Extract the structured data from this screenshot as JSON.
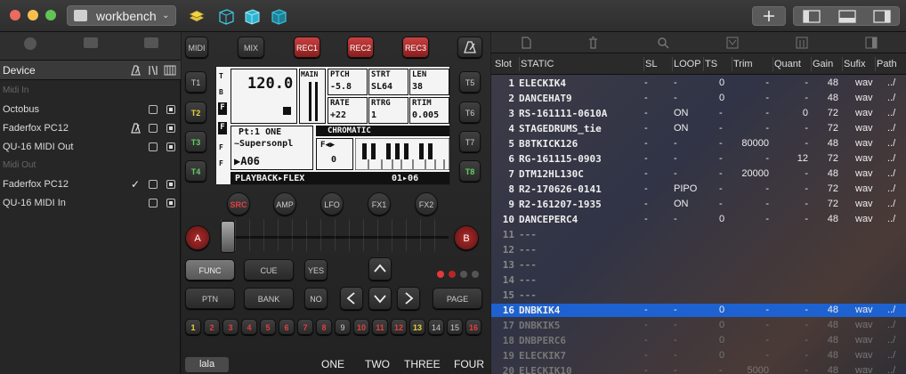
{
  "window": {
    "workspace": "workbench",
    "close_color": "#ed6a5e",
    "minimize_color": "#f5bf4f",
    "zoom_color": "#61c454"
  },
  "left": {
    "header": "Device",
    "sections": [
      {
        "title": "Midi In",
        "items": [
          {
            "name": "Octobus",
            "checked": false
          },
          {
            "name": "Faderfox PC12",
            "checked": false
          },
          {
            "name": "QU-16 MIDI Out",
            "checked": false
          }
        ]
      },
      {
        "title": "Midi Out",
        "items": [
          {
            "name": "Faderfox PC12",
            "checked": true
          },
          {
            "name": "QU-16 MIDI In",
            "checked": false
          }
        ]
      }
    ],
    "checkmark": "✓"
  },
  "device": {
    "top_buttons": {
      "midi": "MIDI",
      "mix": "MIX",
      "rec1": "REC1",
      "rec2": "REC2",
      "rec3": "REC3"
    },
    "tracks_left": [
      "T1",
      "T2",
      "T3",
      "T4"
    ],
    "tracks_right": [
      "T5",
      "T6",
      "T7",
      "T8"
    ],
    "screen": {
      "tempo": "120.0",
      "main": "MAIN",
      "params_top": [
        {
          "label": "PTCH",
          "value": "-5.8"
        },
        {
          "label": "STRT",
          "value": "SL64"
        },
        {
          "label": "LEN",
          "value": "38"
        }
      ],
      "params_bottom": [
        {
          "label": "RATE",
          "value": "+22"
        },
        {
          "label": "RTRG",
          "value": "1"
        },
        {
          "label": "RTIM",
          "value": "0.005"
        }
      ],
      "part": "Pt:1 ONE",
      "sound": "~Supersonpl",
      "pattern": "A06",
      "mode": "CHROMATIC",
      "zero": "0",
      "footer_left": "PLAYBACK▸FLEX",
      "footer_right": "01▸06"
    },
    "row_buttons": {
      "src": "SRC",
      "amp": "AMP",
      "lfo": "LFO",
      "fx1": "FX1",
      "fx2": "FX2"
    },
    "crossfader": {
      "a": "A",
      "b": "B"
    },
    "func_buttons": {
      "func": "FUNC",
      "cue": "CUE",
      "yes": "YES",
      "ptn": "PTN",
      "bank": "BANK",
      "no": "NO",
      "page": "PAGE"
    },
    "trig_keys": [
      "1",
      "2",
      "3",
      "4",
      "5",
      "6",
      "7",
      "8",
      "9",
      "10",
      "11",
      "12",
      "13",
      "14",
      "15",
      "16"
    ],
    "part_label": "lala",
    "parts": [
      "ONE",
      "TWO",
      "THREE",
      "FOUR"
    ]
  },
  "table": {
    "columns": [
      "Slot",
      "STATIC",
      "SL",
      "LOOP",
      "TS",
      "Trim",
      "Quant",
      "Gain",
      "Sufix",
      "Path"
    ],
    "rows": [
      [
        "1",
        "ELECKIK4",
        "-",
        "-",
        "0",
        "-",
        "-",
        "48",
        "wav",
        "../"
      ],
      [
        "2",
        "DANCEHAT9",
        "-",
        "-",
        "0",
        "-",
        "-",
        "48",
        "wav",
        "../"
      ],
      [
        "3",
        "RS-161111-0610A",
        "-",
        "ON",
        "-",
        "-",
        "0",
        "72",
        "wav",
        "../"
      ],
      [
        "4",
        "STAGEDRUMS_tie",
        "-",
        "ON",
        "-",
        "-",
        "-",
        "72",
        "wav",
        "../"
      ],
      [
        "5",
        "B8TKICK126",
        "-",
        "-",
        "-",
        "80000",
        "-",
        "48",
        "wav",
        "../"
      ],
      [
        "6",
        "RG-161115-0903",
        "-",
        "-",
        "-",
        "-",
        "12",
        "72",
        "wav",
        "../"
      ],
      [
        "7",
        "DTM12HL130C",
        "-",
        "-",
        "-",
        "20000",
        "-",
        "48",
        "wav",
        "../"
      ],
      [
        "8",
        "R2-170626-0141",
        "-",
        "PIPO",
        "-",
        "-",
        "-",
        "72",
        "wav",
        "../"
      ],
      [
        "9",
        "R2-161207-1935",
        "-",
        "ON",
        "-",
        "-",
        "-",
        "72",
        "wav",
        "../"
      ],
      [
        "10",
        "DANCEPERC4",
        "-",
        "-",
        "0",
        "-",
        "-",
        "48",
        "wav",
        "../"
      ],
      [
        "11",
        "---",
        "",
        "",
        "",
        "",
        "",
        "",
        "",
        ""
      ],
      [
        "12",
        "---",
        "",
        "",
        "",
        "",
        "",
        "",
        "",
        ""
      ],
      [
        "13",
        "---",
        "",
        "",
        "",
        "",
        "",
        "",
        "",
        ""
      ],
      [
        "14",
        "---",
        "",
        "",
        "",
        "",
        "",
        "",
        "",
        ""
      ],
      [
        "15",
        "---",
        "",
        "",
        "",
        "",
        "",
        "",
        "",
        ""
      ],
      [
        "16",
        "DNBKIK4",
        "-",
        "-",
        "0",
        "-",
        "-",
        "48",
        "wav",
        "../"
      ],
      [
        "17",
        "DNBKIK5",
        "-",
        "-",
        "0",
        "-",
        "-",
        "48",
        "wav",
        "../"
      ],
      [
        "18",
        "DNBPERC6",
        "-",
        "-",
        "0",
        "-",
        "-",
        "48",
        "wav",
        "../"
      ],
      [
        "19",
        "ELECKIK7",
        "-",
        "-",
        "0",
        "-",
        "-",
        "48",
        "wav",
        "../"
      ],
      [
        "20",
        "ELECKIK10",
        "-",
        "-",
        "-",
        "5000",
        "-",
        "48",
        "wav",
        "../"
      ]
    ],
    "selected_row": 16
  }
}
